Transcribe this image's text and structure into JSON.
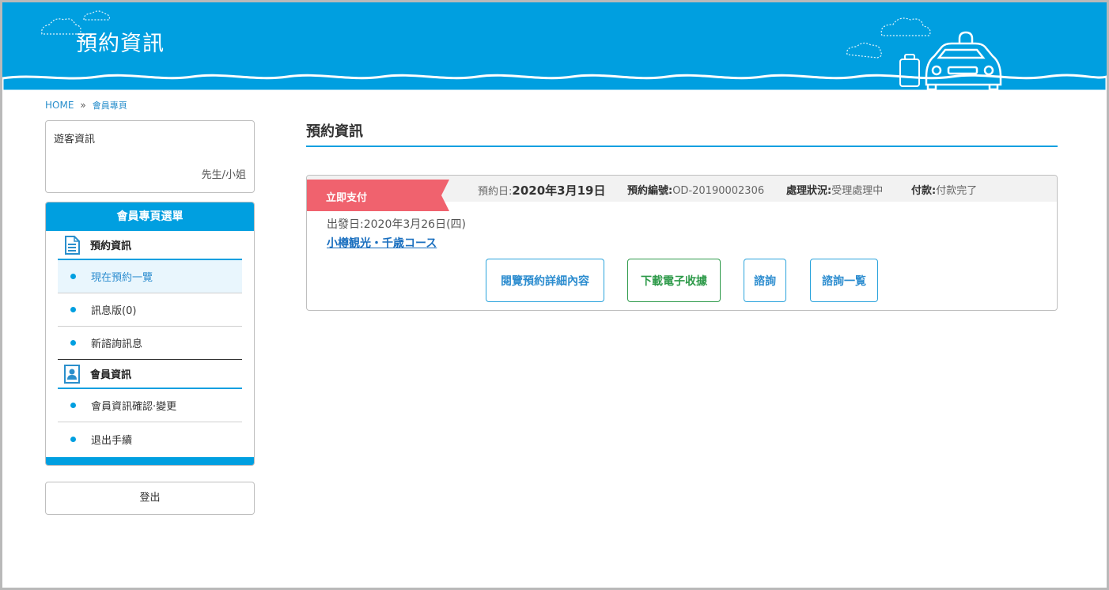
{
  "header": {
    "title": "預約資訊",
    "brand_color": "#009fe0"
  },
  "breadcrumb": {
    "home": "HOME",
    "separator": "»",
    "current": "會員專頁"
  },
  "guest": {
    "label": "遊客資訊",
    "honorific": "先生/小姐"
  },
  "menu": {
    "title": "會員專頁選單",
    "sections": [
      {
        "label": "預約資訊",
        "icon": "document-icon",
        "items": [
          "現在預約一覽",
          "訊息版(0)",
          "新諮詢訊息"
        ]
      },
      {
        "label": "會員資訊",
        "icon": "member-card-icon",
        "items": [
          "會員資訊確認·變更",
          "退出手續"
        ]
      }
    ]
  },
  "logout": "登出",
  "main": {
    "title": "預約資訊",
    "reservation": {
      "pay_label": "立即支付",
      "date_label": "預約日:",
      "date_value": "2020年3月19日",
      "number_label": "預約編號:",
      "number_value": "OD-20190002306",
      "status_label": "處理狀況:",
      "status_value": "受理處理中",
      "payment_label": "付款:",
      "payment_value": "付款完了",
      "depart_label": "出發日:",
      "depart_value": "2020年3月26日(四)",
      "tour_name": "小樽観光・千歳コース",
      "buttons": {
        "details": "閱覽預約詳細內容",
        "receipt": "下載電子收據",
        "inquiry": "諮詢",
        "inquiry_list": "諮詢一覧"
      }
    }
  }
}
